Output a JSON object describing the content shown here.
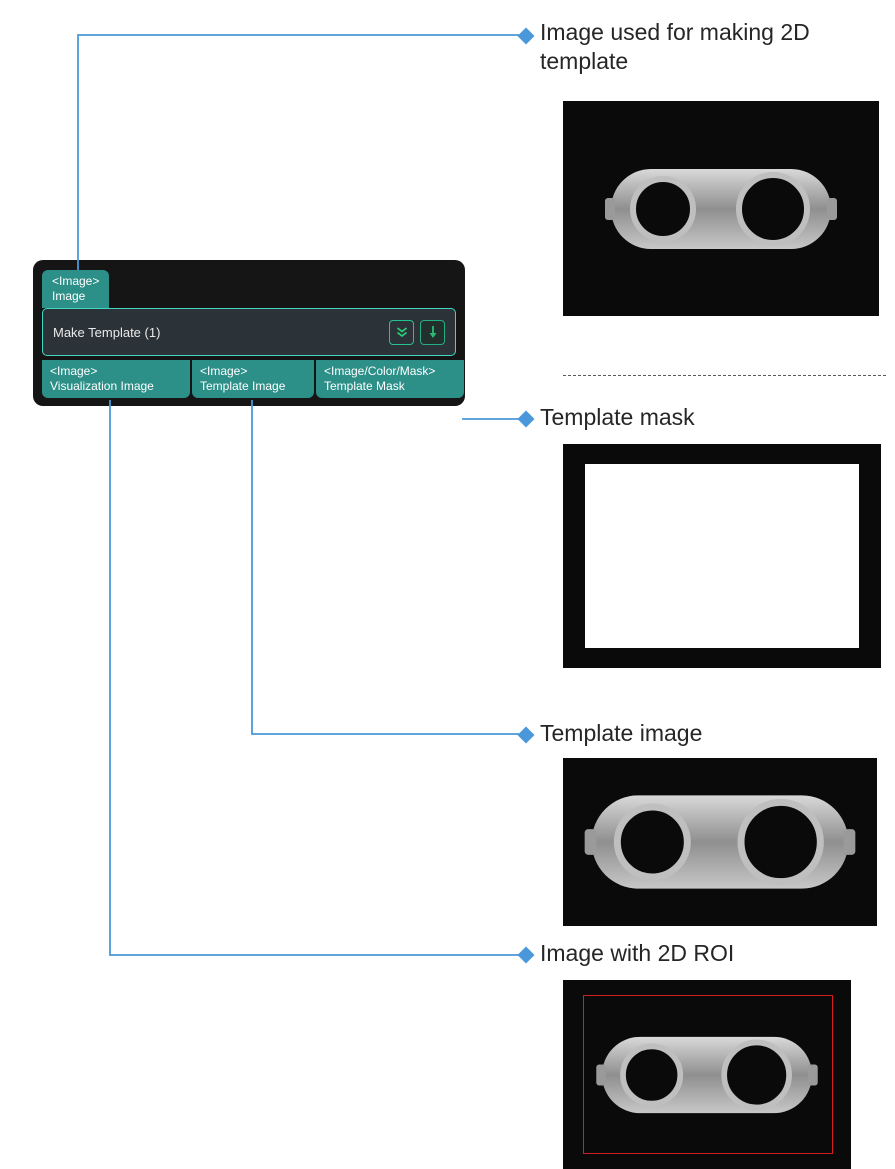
{
  "node": {
    "input": {
      "type": "<Image>",
      "label": "Image"
    },
    "title": "Make Template (1)",
    "outputs": [
      {
        "type": "<Image>",
        "label": "Visualization Image"
      },
      {
        "type": "<Image>",
        "label": "Template Image"
      },
      {
        "type": "<Image/Color/Mask>",
        "label": "Template Mask"
      }
    ]
  },
  "labels": {
    "input_image": "Image used for making 2D template",
    "template_mask": "Template mask",
    "template_image": "Template image",
    "image_with_roi": "Image with 2D ROI"
  }
}
